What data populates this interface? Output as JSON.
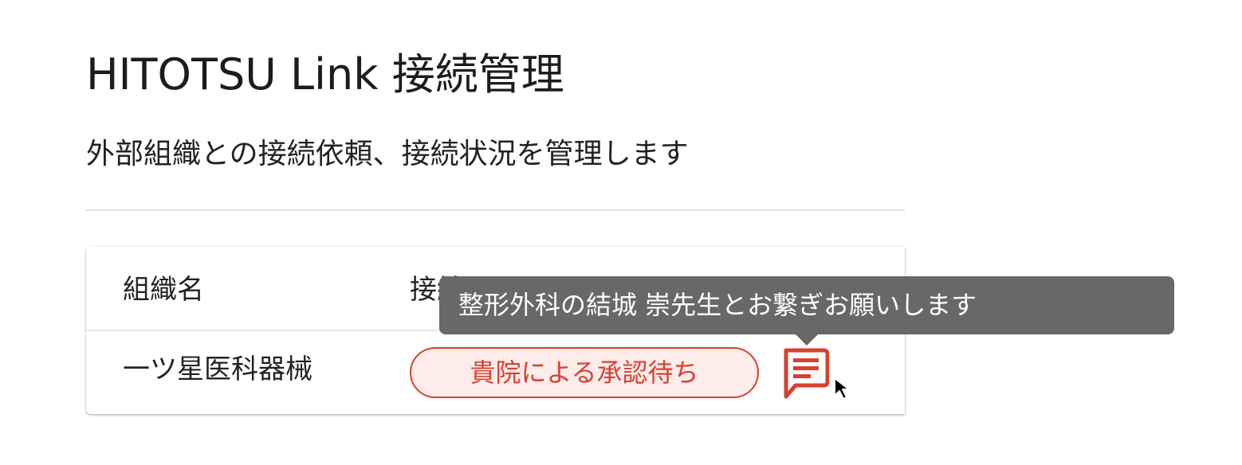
{
  "header": {
    "title": "HITOTSU Link 接続管理",
    "subtitle": "外部組織との接続依頼、接続状況を管理します"
  },
  "table": {
    "columns": [
      "組織名",
      "接続ステータス"
    ],
    "rows": [
      {
        "organization": "一ツ星医科器械",
        "status": "貴院による承認待ち",
        "message_icon": "message-icon"
      }
    ]
  },
  "tooltip": {
    "text": "整形外科の結城 崇先生とお繋ぎお願いします"
  },
  "colors": {
    "status_accent": "#d9402f",
    "status_background": "#fdecea",
    "tooltip_background": "#686868"
  }
}
